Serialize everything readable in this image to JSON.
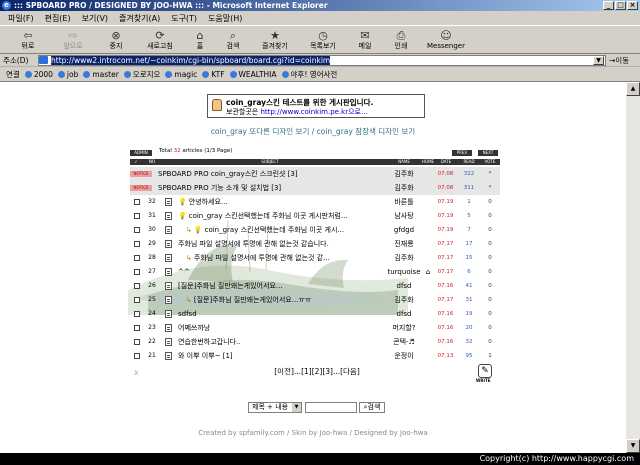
{
  "window": {
    "title": "::: SPBOARD PRO / DESIGNED BY JOO-HWA ::: - Microsoft Internet Explorer"
  },
  "menu": [
    "파일(F)",
    "편집(E)",
    "보기(V)",
    "즐겨찾기(A)",
    "도구(T)",
    "도움말(H)"
  ],
  "toolbar": [
    {
      "label": "뒤로",
      "icon": "back-arrow-icon",
      "glyph": "⇦",
      "disabled": false
    },
    {
      "label": "앞으로",
      "icon": "forward-arrow-icon",
      "glyph": "⇨",
      "disabled": true
    },
    {
      "label": "중지",
      "icon": "stop-icon",
      "glyph": "⊗",
      "disabled": false
    },
    {
      "label": "새로고침",
      "icon": "refresh-icon",
      "glyph": "⟳",
      "disabled": false
    },
    {
      "label": "홈",
      "icon": "home-icon",
      "glyph": "⌂",
      "disabled": false
    },
    {
      "label": "검색",
      "icon": "search-icon",
      "glyph": "⌕",
      "disabled": false
    },
    {
      "label": "즐겨찾기",
      "icon": "favorites-icon",
      "glyph": "★",
      "disabled": false
    },
    {
      "label": "목록보기",
      "icon": "history-icon",
      "glyph": "◷",
      "disabled": false
    },
    {
      "label": "메일",
      "icon": "mail-icon",
      "glyph": "✉",
      "disabled": false
    },
    {
      "label": "인쇄",
      "icon": "print-icon",
      "glyph": "⎙",
      "disabled": false
    },
    {
      "label": "Messenger",
      "icon": "messenger-icon",
      "glyph": "☺",
      "disabled": false
    }
  ],
  "address": {
    "label": "주소(D)",
    "url": "http://www2.introcom.net/~coinkim/cgi-bin/spboard/board.cgi?id=coinkim",
    "go_label": "이동"
  },
  "links": {
    "label": "연결",
    "items": [
      "2000",
      "job",
      "master",
      "오로지오",
      "magic",
      "KTF",
      "WEALTHIA",
      "야후! 영어사전"
    ]
  },
  "notice_box": {
    "title": "coin_gray스킨 테스트를 위한 게시판입니다.",
    "sub_label": "보관할곳은",
    "sub_url": "http://www.coinkim.pe.kr으로..."
  },
  "design_links": "coin_gray 또다른 디자인 보기 / coin_gray 잠장색 디자인 보기",
  "board": {
    "admin_label": "ADMIN",
    "total_prefix": "Total",
    "total_count": "32",
    "total_suffix": "articles (1/3 Page)",
    "prev_label": "PREV",
    "next_label": "NEXT",
    "columns": {
      "no": "NO",
      "subject": "SUBJECT",
      "name": "NAME",
      "home": "HOME",
      "date": "DATE",
      "read": "READ",
      "vote": "VOTE"
    },
    "notice_label": "NOTICE",
    "rows": [
      {
        "notice": true,
        "subject": "SPBOARD PRO coin_gray스킨 스크린샷",
        "count": "[3]",
        "name": "김주화",
        "date": "07.08",
        "read": "322",
        "vote": "*"
      },
      {
        "notice": true,
        "subject": "SPBOARD PRO 기능 소개 및 설치법",
        "count": "[3]",
        "name": "김주화",
        "date": "07.08",
        "read": "311",
        "vote": "*"
      },
      {
        "num": "32",
        "depth": 0,
        "reply": false,
        "bulb": true,
        "subject": "안녕하세요...",
        "name": "바른틀",
        "date": "07.19",
        "read": "1",
        "vote": "0"
      },
      {
        "num": "31",
        "depth": 0,
        "reply": false,
        "bulb": true,
        "subject": "coin_gray 스킨선택했는데 주화님 이곳 게시판처럼...",
        "name": "남사탕",
        "date": "07.19",
        "read": "5",
        "vote": "0"
      },
      {
        "num": "30",
        "depth": 1,
        "reply": true,
        "bulb": true,
        "subject": "coin_gray 스킨선택했는데 주화님 이곳 게시...",
        "name": "gfdgd",
        "date": "07.19",
        "read": "7",
        "vote": "0"
      },
      {
        "num": "29",
        "depth": 0,
        "reply": false,
        "bulb": false,
        "subject": "주화님 파일 설명서에 투명에 관해 없는것 같습니다.",
        "name": "진재룡",
        "date": "07.17",
        "read": "17",
        "vote": "0"
      },
      {
        "num": "28",
        "depth": 1,
        "reply": true,
        "bulb": false,
        "subject": "주화님 파일 설명서에 투명에 관해 없는것 같...",
        "name": "김주화",
        "date": "07.17",
        "read": "15",
        "vote": "0"
      },
      {
        "num": "27",
        "depth": 0,
        "reply": false,
        "bulb": false,
        "subject": "^^",
        "name": "turquoise",
        "home": "⌂",
        "date": "07.17",
        "read": "6",
        "vote": "0"
      },
      {
        "num": "26",
        "depth": 0,
        "reply": false,
        "bulb": false,
        "subject": "[질문]주화님 질만왜는게있어서요...",
        "name": "dfsd",
        "date": "07.16",
        "read": "41",
        "vote": "0"
      },
      {
        "num": "25",
        "depth": 1,
        "reply": true,
        "bulb": false,
        "subject": "[질문]주화님 질만왜는게있어서요...ㅠㅠ",
        "name": "김주화",
        "date": "07.17",
        "read": "31",
        "vote": "0"
      },
      {
        "num": "24",
        "depth": 0,
        "reply": false,
        "bulb": false,
        "subject": "sdfsd",
        "name": "dfsd",
        "date": "07.16",
        "read": "19",
        "vote": "0"
      },
      {
        "num": "23",
        "depth": 0,
        "reply": false,
        "bulb": false,
        "subject": "어쩨쓰까낭",
        "name": "머지할?",
        "date": "07.16",
        "read": "20",
        "vote": "0"
      },
      {
        "num": "22",
        "depth": 0,
        "reply": false,
        "bulb": false,
        "subject": "연습한번하고갑니다..",
        "name": "콘텍-♬",
        "date": "07.16",
        "read": "32",
        "vote": "0"
      },
      {
        "num": "21",
        "depth": 0,
        "reply": false,
        "bulb": false,
        "subject": "와 이뿌 이뿌~",
        "count": "[1]",
        "name": "운정이",
        "date": "07.13",
        "read": "95",
        "vote": "1"
      }
    ]
  },
  "pager": {
    "prev": "[이전]...",
    "pages": [
      "[1]",
      "[2]",
      "[3]"
    ],
    "next": "...[다음]",
    "x_mark": "x"
  },
  "write_label": "WRITE",
  "search": {
    "select_value": "제목 + 내용",
    "button_label": "검색"
  },
  "credits": "Created by spfamily.com / Skin by Joo-hwa / Designed by Joo-hwa",
  "status": "Copyright(c) http://www.happycgi.com"
}
